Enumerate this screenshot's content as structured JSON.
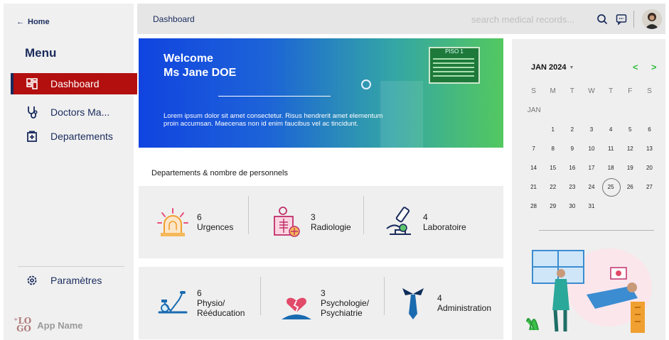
{
  "sidebar": {
    "home_label": "Home",
    "menu_title": "Menu",
    "items": [
      {
        "label": "Dashboard",
        "icon": "dashboard-grid-icon"
      },
      {
        "label": "Doctors Ma...",
        "icon": "stethoscope-icon"
      },
      {
        "label": "Departements",
        "icon": "hospital-building-icon"
      }
    ],
    "settings_label": "Paramètres",
    "settings_icon": "gear-icon",
    "logo_text": "LOGO",
    "app_name": "App Name"
  },
  "topbar": {
    "breadcrumb": "Dashboard",
    "search_placeholder": "search medical records...",
    "icons": [
      "search-icon",
      "chat-icon"
    ]
  },
  "banner": {
    "greeting": "Welcome",
    "name": "Ms Jane DOE",
    "text": "Lorem ipsum dolor sit amet consectetur. Risus hendrerit amet elementum proin accumsan. Maecenas non id enim faucibus vel ac tincidunt.",
    "sign_text": "PISO 1"
  },
  "departments": {
    "title": "Departements & nombre de personnels",
    "row1": [
      {
        "count": "6",
        "name": "Urgences",
        "icon": "emergency-siren-icon"
      },
      {
        "count": "3",
        "name": "Radiologie",
        "icon": "xray-icon"
      },
      {
        "count": "4",
        "name": "Laboratoire",
        "icon": "microscope-icon"
      }
    ],
    "row2": [
      {
        "count": "6",
        "name": "Physio/\nRééducation",
        "name_1": "Physio/",
        "name_2": "Rééducation",
        "icon": "exercise-bike-icon"
      },
      {
        "count": "3",
        "name_1": "Psychologie/",
        "name_2": "Psychiatrie",
        "icon": "broken-heart-head-icon"
      },
      {
        "count": "4",
        "name": "Administration",
        "icon": "necktie-icon"
      }
    ]
  },
  "calendar": {
    "month_label": "JAN 2024",
    "weekdays": [
      "S",
      "M",
      "T",
      "W",
      "T",
      "F",
      "S"
    ],
    "month_short": "JAN",
    "weeks": [
      [
        "",
        "1",
        "2",
        "3",
        "4",
        "5",
        "6"
      ],
      [
        "7",
        "8",
        "9",
        "10",
        "11",
        "12",
        "13"
      ],
      [
        "14",
        "15",
        "16",
        "17",
        "18",
        "19",
        "20"
      ],
      [
        "21",
        "22",
        "23",
        "24",
        "25",
        "26",
        "27"
      ],
      [
        "28",
        "29",
        "30",
        "31",
        "",
        "",
        ""
      ]
    ],
    "selected_day": "25",
    "prev_label": "<",
    "next_label": ">"
  },
  "colors": {
    "active_nav": "#b30f0f",
    "navy": "#1a2b5c",
    "calendar_accent": "#2ebd3c"
  }
}
